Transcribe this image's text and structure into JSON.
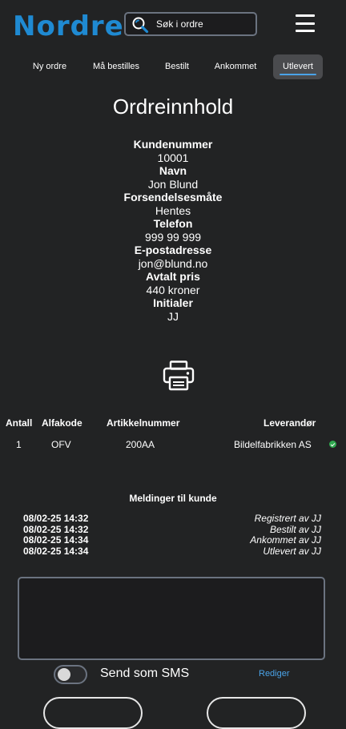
{
  "header": {
    "logo_text": "Nordre",
    "search_placeholder": "Søk i ordre"
  },
  "tabs": [
    {
      "label": "Ny ordre"
    },
    {
      "label": "Må bestilles"
    },
    {
      "label": "Bestilt"
    },
    {
      "label": "Ankommet"
    },
    {
      "label": "Utlevert",
      "active": true
    }
  ],
  "page_title": "Ordreinnhold",
  "order_info": {
    "customer_number_label": "Kundenummer",
    "customer_number": "10001",
    "name_label": "Navn",
    "name": "Jon Blund",
    "shipping_label": "Forsendelsesmåte",
    "shipping": "Hentes",
    "phone_label": "Telefon",
    "phone": "999 99 999",
    "email_label": "E-postadresse",
    "email": "jon@blund.no",
    "price_label": "Avtalt pris",
    "price": "440 kroner",
    "initials_label": "Initialer",
    "initials": "JJ"
  },
  "table": {
    "headers": [
      "Antall",
      "Alfakode",
      "Artikkelnummer",
      "Leverandør"
    ],
    "rows": [
      {
        "quantity": "1",
        "alfakode": "OFV",
        "article_number": "200AA",
        "supplier": "Bildelfabrikken AS",
        "status": "confirmed"
      }
    ]
  },
  "messages": {
    "title": "Meldinger til kunde",
    "entries": [
      {
        "date": "08/02-25 14:32",
        "text": "Registrert av JJ"
      },
      {
        "date": "08/02-25 14:32",
        "text": "Bestilt av JJ"
      },
      {
        "date": "08/02-25 14:34",
        "text": "Ankommet av JJ"
      },
      {
        "date": "08/02-25 14:34",
        "text": "Utlevert av JJ"
      }
    ],
    "textarea_value": ""
  },
  "sms": {
    "label": "Send som SMS",
    "enabled": false
  },
  "edit_label": "Rediger",
  "colors": {
    "background": "#222324",
    "accent": "#1f8ad2",
    "link": "#4aa3e8",
    "active_tab": "#4a4b4e",
    "status_ok": "#2fa84f"
  },
  "icons": {
    "search": "magnifier-icon",
    "menu": "hamburger-menu-icon",
    "print": "printer-icon",
    "status": "check-circle-icon"
  }
}
